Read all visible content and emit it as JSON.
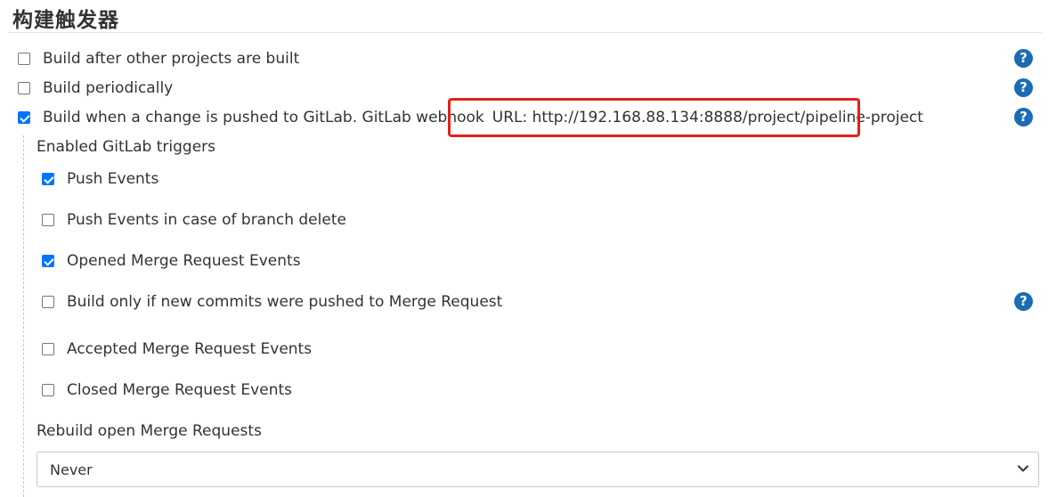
{
  "section": {
    "title": "构建触发器"
  },
  "triggers": {
    "after_other": {
      "label": "Build after other projects are built",
      "checked": false
    },
    "periodically": {
      "label": "Build periodically",
      "checked": false
    },
    "gitlab": {
      "label": "Build when a change is pushed to GitLab. GitLab webhook",
      "url_text": "URL: http://192.168.88.134:8888/project/pipeline-project",
      "checked": true
    }
  },
  "gitlab_triggers": {
    "heading": "Enabled GitLab triggers",
    "push_events": {
      "label": "Push Events",
      "checked": true
    },
    "push_branch_delete": {
      "label": "Push Events in case of branch delete",
      "checked": false
    },
    "opened_mr": {
      "label": "Opened Merge Request Events",
      "checked": true
    },
    "only_new_commits": {
      "label": "Build only if new commits were pushed to Merge Request",
      "checked": false
    },
    "accepted_mr": {
      "label": "Accepted Merge Request Events",
      "checked": false
    },
    "closed_mr": {
      "label": "Closed Merge Request Events",
      "checked": false
    }
  },
  "rebuild": {
    "label": "Rebuild open Merge Requests",
    "selected": "Never"
  },
  "help": {
    "glyph": "?",
    "icon": "help-icon",
    "color": "#1b6cb5"
  },
  "colors": {
    "highlight": "#e3211c",
    "checkbox_checked": "#0075ff"
  }
}
